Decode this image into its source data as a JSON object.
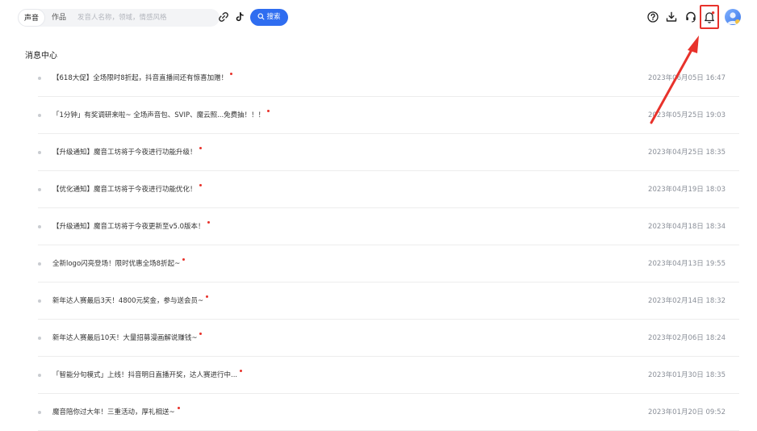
{
  "header": {
    "segments": {
      "voice": "声音",
      "works": "作品"
    },
    "search": {
      "placeholder": "发音人名称，领域，情感风格",
      "button_label": "搜索"
    },
    "icons": [
      "link-icon",
      "tiktok-icon",
      "help-icon",
      "download-icon",
      "headset-icon",
      "bell-icon"
    ]
  },
  "page": {
    "title": "消息中心"
  },
  "messages": [
    {
      "text": "【618大促】全场限时8折起，抖音直播间还有惊喜加赠！",
      "time": "2023年06月05日 16:47",
      "unread": true
    },
    {
      "text": "「1分钟」有奖调研来啦~ 全场声音包、SVIP、魔云照...免费抽！！！",
      "time": "2023年05月25日 19:03",
      "unread": true
    },
    {
      "text": "【升级通知】魔音工坊将于今夜进行功能升级！",
      "time": "2023年04月25日 18:35",
      "unread": true
    },
    {
      "text": "【优化通知】魔音工坊将于今夜进行功能优化！",
      "time": "2023年04月19日 18:03",
      "unread": true
    },
    {
      "text": "【升级通知】魔音工坊将于今夜更新至v5.0版本！",
      "time": "2023年04月18日 18:34",
      "unread": true
    },
    {
      "text": "全新logo闪亮登场！限时优惠全场8折起~",
      "time": "2023年04月13日 19:55",
      "unread": true
    },
    {
      "text": "新年达人赛最后3天！4800元奖金，参与送会员~",
      "time": "2023年02月14日 18:32",
      "unread": true
    },
    {
      "text": "新年达人赛最后10天！大量招募漫画解说赚钱~",
      "time": "2023年02月06日 18:24",
      "unread": true
    },
    {
      "text": "「智能分句模式」上线！抖音明日直播开奖，达人赛进行中...",
      "time": "2023年01月30日 18:35",
      "unread": true
    },
    {
      "text": "魔音陪你过大年！三重活动，厚礼相送~",
      "time": "2023年01月20日 09:52",
      "unread": true
    }
  ],
  "colors": {
    "accent": "#2f6df0",
    "highlight": "#e8322b",
    "unread_dot": "#e8322b"
  }
}
